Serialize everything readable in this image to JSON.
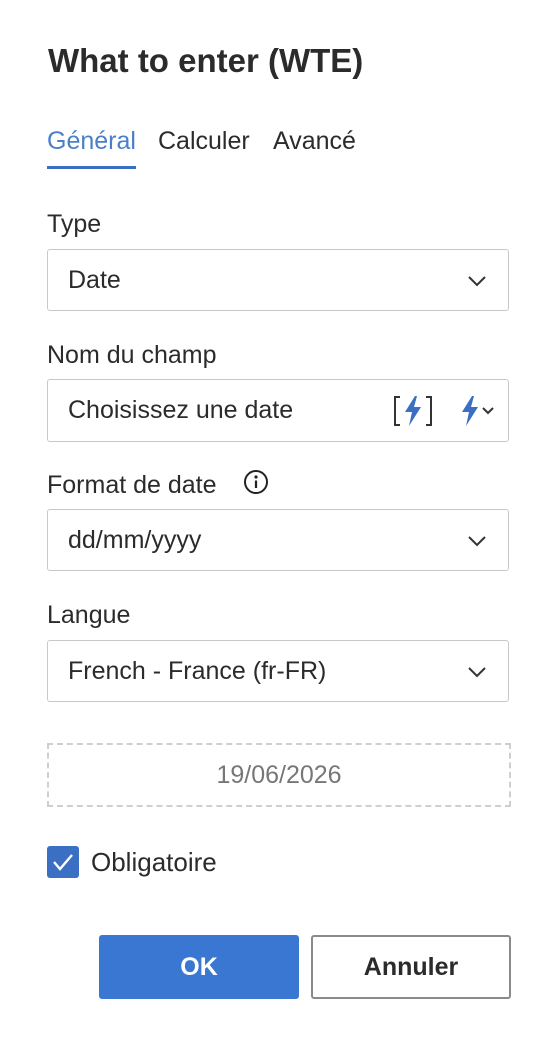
{
  "dialog": {
    "title": "What to enter (WTE)"
  },
  "tabs": [
    {
      "label": "Général",
      "active": true
    },
    {
      "label": "Calculer",
      "active": false
    },
    {
      "label": "Avancé",
      "active": false
    }
  ],
  "fields": {
    "type": {
      "label": "Type",
      "value": "Date"
    },
    "field_name": {
      "label": "Nom du champ",
      "value": "Choisissez une date"
    },
    "date_format": {
      "label": "Format de date",
      "value": "dd/mm/yyyy"
    },
    "language": {
      "label": "Langue",
      "value": "French - France (fr-FR)"
    }
  },
  "preview": {
    "value": "19/06/2026"
  },
  "required": {
    "label": "Obligatoire",
    "checked": true
  },
  "buttons": {
    "ok": "OK",
    "cancel": "Annuler"
  },
  "icons": {
    "chevron": "chevron-down-icon",
    "lightning_bracket": "lightning-bracket-icon",
    "lightning_dropdown": "lightning-dropdown-icon",
    "info": "info-icon",
    "check": "checkmark-icon"
  },
  "colors": {
    "accent": "#3a77d3",
    "tab_active": "#4a7fc9",
    "lightning": "#3a6fc4"
  }
}
